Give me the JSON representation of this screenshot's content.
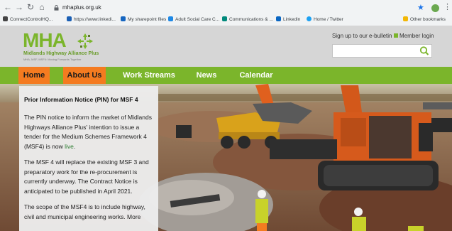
{
  "browser": {
    "url": "mhaplus.org.uk",
    "bookmarks": [
      {
        "label": "ConnectControlHQ...",
        "color": "#444444"
      },
      {
        "label": "https://www.linkedi...",
        "color": "#1a5fb4"
      },
      {
        "label": "My sharepoint files",
        "color": "#1565c0"
      },
      {
        "label": "Adult Social Care C...",
        "color": "#1e88e5"
      },
      {
        "label": "Communications & ...",
        "color": "#00897b"
      },
      {
        "label": "Linkedin",
        "color": "#0a66c2"
      },
      {
        "label": "Home / Twitter",
        "color": "#1da1f2"
      },
      {
        "label": "Other bookmarks",
        "color": "#f2b705"
      }
    ]
  },
  "header": {
    "logo_text": "MHA",
    "logo_subtitle": "Midlands Highway Alliance Plus",
    "logo_tagline": "MHA, MSF, MSF4: Moving Forwards Together",
    "signup_label": "Sign up to our e-bulletin",
    "member_label": "Member login",
    "search_placeholder": ""
  },
  "nav": {
    "items": [
      {
        "label": "Home",
        "active": true
      },
      {
        "label": "About Us",
        "active": true
      },
      {
        "label": "Work Streams",
        "active": false
      },
      {
        "label": "News",
        "active": false
      },
      {
        "label": "Calendar",
        "active": false
      }
    ]
  },
  "notice": {
    "title": "Prior Information Notice (PIN) for MSF 4",
    "para1_before": "The PIN notice to inform the market of Midlands Highways Alliance Plus' intention to issue a tender for the Medium Schemes Framework 4 (MSF4) is now ",
    "para1_link": "live",
    "para1_after": ".",
    "para2": "The MSF 4 will replace the existing MSF 3 and preparatory work for the re-procurement is currently underway. The Contract Notice is anticipated to be published in April 2021.",
    "para3": "The scope of the MSF4 is to include highway, civil and municipal engineering works. More"
  },
  "colors": {
    "brand_green": "#7bb52b",
    "nav_active": "#f47b20",
    "header_bg": "#d6d6d6"
  }
}
